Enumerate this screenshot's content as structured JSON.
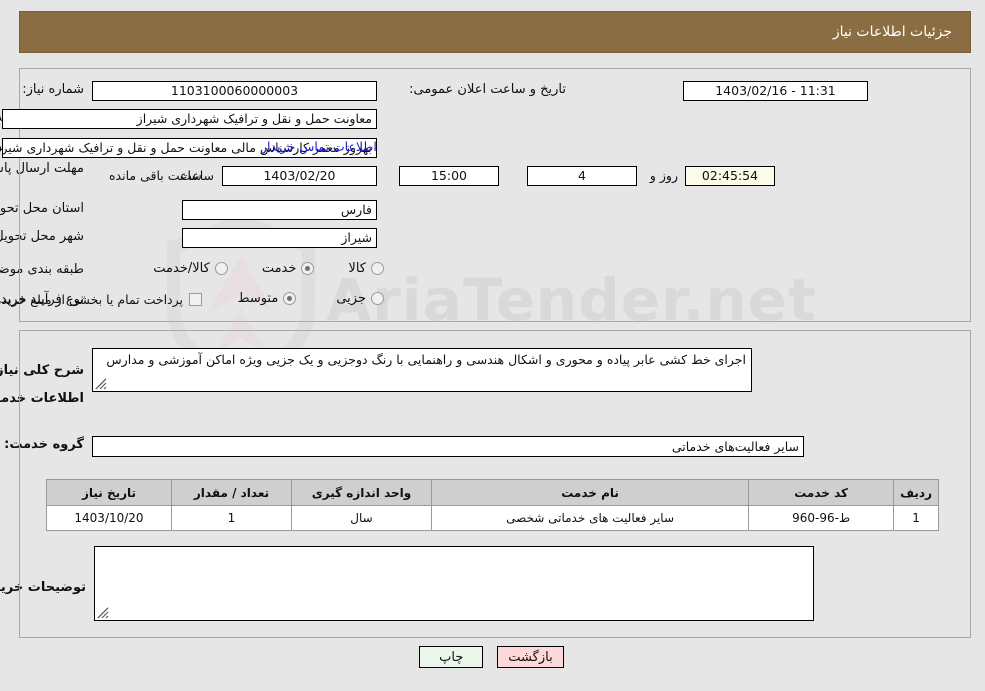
{
  "header": {
    "title": "جزئیات اطلاعات نیاز"
  },
  "colors": {
    "header_bg": "#8a6d43",
    "header_text": "#ffffff",
    "page_bg": "#e6e6e6",
    "link": "#1818c8",
    "countdown_bg": "#fbfbe8",
    "table_header_bg": "#cfcfcf",
    "print_btn_bg": "#eaf7ea",
    "back_btn_bg": "#fcd8d8"
  },
  "form": {
    "need_number_label": "شماره نیاز:",
    "need_number_value": "1103100060000003",
    "announce_label": "تاریخ و ساعت اعلان عمومی:",
    "announce_value": "1403/02/16 - 11:31",
    "buyer_org_label": "نام دستگاه خریدار:",
    "buyer_org_value": "معاونت حمل و نقل و ترافیک شهرداری شیراز",
    "requester_label": "ایجاد کننده درخواست:",
    "requester_value": "بهروز معمر کارشناس مالی معاونت حمل و نقل و ترافیک شهرداری شیراز",
    "contact_link": "اطلاعات تماس خریدار",
    "deadline_label": "مهلت ارسال پاسخ: تا تاریخ:",
    "deadline_date": "1403/02/20",
    "hour_label": "ساعت",
    "deadline_time": "15:00",
    "days_value": "4",
    "days_label": "روز و",
    "countdown_value": "02:45:54",
    "countdown_label": "ساعت باقی مانده",
    "province_label": "استان محل تحویل:",
    "province_value": "فارس",
    "city_label": "شهر محل تحویل:",
    "city_value": "شیراز",
    "category_label": "طبقه بندی موضوعی:",
    "category_options": [
      {
        "label": "کالا",
        "selected": false
      },
      {
        "label": "خدمت",
        "selected": true
      },
      {
        "label": "کالا/خدمت",
        "selected": false
      }
    ],
    "process_label": "نوع فرآیند خرید :",
    "process_options": [
      {
        "label": "جزیی",
        "selected": false
      },
      {
        "label": "متوسط",
        "selected": true
      }
    ],
    "treasury_checkbox_checked": false,
    "treasury_note": "پرداخت تمام یا بخشی از مبلغ خرید،از محل \"اسناد خزانه اسلامی\" خواهد بود."
  },
  "description": {
    "label": "شرح کلی نیاز:",
    "value": "اجرای خط کشی عابر پیاده و محوری و اشکال هندسی و راهنمایی با رنگ دوجزیی و یک جزیی ویژه اماکن آموزشی و مدارس"
  },
  "services_section": {
    "heading": "اطلاعات خدمات مورد نیاز",
    "group_label": "گروه خدمت:",
    "group_value": "سایر فعالیت‌های خدماتی"
  },
  "table": {
    "columns": [
      "ردیف",
      "کد خدمت",
      "نام خدمت",
      "واحد اندازه گیری",
      "تعداد / مقدار",
      "تاریخ نیاز"
    ],
    "rows": [
      {
        "index": "1",
        "code": "ط-96-960",
        "name": "سایر فعالیت های خدماتی شخصی",
        "unit": "سال",
        "quantity": "1",
        "need_date": "1403/10/20"
      }
    ]
  },
  "buyer_notes": {
    "label": "توضیحات خریدار:",
    "value": ""
  },
  "buttons": {
    "print": "چاپ",
    "back": "بازگشت"
  },
  "watermark": {
    "text": "AriaTender.net"
  }
}
